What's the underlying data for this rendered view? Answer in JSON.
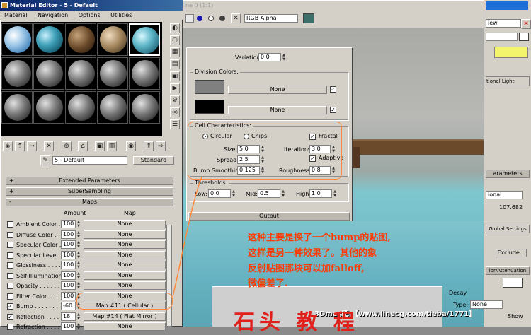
{
  "material_editor": {
    "title": "Material Editor - 5 - Default",
    "menu": [
      "Material",
      "Navigation",
      "Options",
      "Utilities"
    ],
    "material_name": "5 - Default",
    "material_type": "Standard",
    "rollouts": {
      "extended": "Extended Parameters",
      "supersampling": "SuperSampling",
      "maps": "Maps"
    },
    "maps_header": {
      "amount": "Amount",
      "map": "Map"
    },
    "maps": [
      {
        "label": "Ambient Color . .",
        "checked": false,
        "amount": "100",
        "map": "None"
      },
      {
        "label": "Diffuse Color . . .",
        "checked": false,
        "amount": "100",
        "map": "None"
      },
      {
        "label": "Specular Color . .",
        "checked": false,
        "amount": "100",
        "map": "None"
      },
      {
        "label": "Specular Level . .",
        "checked": false,
        "amount": "100",
        "map": "None"
      },
      {
        "label": "Glossiness . . . . .",
        "checked": false,
        "amount": "100",
        "map": "None"
      },
      {
        "label": "Self-Illumination .",
        "checked": false,
        "amount": "100",
        "map": "None"
      },
      {
        "label": "Opacity . . . . . .",
        "checked": false,
        "amount": "100",
        "map": "None"
      },
      {
        "label": "Filter Color . . .",
        "checked": false,
        "amount": "100",
        "map": "None"
      },
      {
        "label": "Bump . . . . . . .",
        "checked": true,
        "amount": "-60",
        "map": "Map #11  ( Cellular )"
      },
      {
        "label": "Reflection . . . .",
        "checked": true,
        "amount": "18",
        "map": "Map #14  ( Flat Mirror )"
      },
      {
        "label": "Refraction . . . .",
        "checked": false,
        "amount": "100",
        "map": "None"
      }
    ]
  },
  "render_window": {
    "title": "ne 0 (1:1)",
    "channel": "RGB Alpha"
  },
  "cellular": {
    "variation_label": "Variation:",
    "variation": "0.0",
    "division_colors_label": "Division Colors:",
    "color1_map": "None",
    "color2_map": "None",
    "cell_char_label": "Cell Characteristics:",
    "circular": "Circular",
    "chips": "Chips",
    "fractal": "Fractal",
    "adaptive": "Adaptive",
    "size_label": "Size:",
    "size": "5.0",
    "spread_label": "Spread:",
    "spread": "2.5",
    "bump_smoothing_label": "Bump Smoothing:",
    "bump_smoothing": "0.125",
    "iterations_label": "Iterations:",
    "iterations": "3.0",
    "roughness_label": "Roughness:",
    "roughness": "0.8",
    "thresholds_label": "Thresholds:",
    "low_label": "Low:",
    "low": "0.0",
    "mid_label": "Mid:",
    "mid": "0.5",
    "high_label": "High:",
    "high": "1.0",
    "output_label": "Output"
  },
  "command_panel": {
    "view_label": "iew",
    "light_label": "tional Light",
    "parameters_label": "arameters",
    "dropdown_value": "ional",
    "value_readout": "107.682",
    "global_settings": "Global Settings",
    "exclude": "Exclude...",
    "attenuation": "ior/Attenuation",
    "decay_label": "Decay",
    "type_label": "Type:",
    "type_value": "None",
    "show_label": "Show"
  },
  "annotation": {
    "line1": "这种主要是换了一个bump的贴图,",
    "line2": "这样是另一种效果了。其他的象",
    "line3": "反射贴图那块可以加falloff,",
    "line4": "微偏差了.",
    "watermark": "3Dmax吧 【www.linecg.com/tieba/1771】",
    "bottom_big": "石头 教 程"
  },
  "colors": {
    "ui_gray": "#d4d0c8",
    "title_blue": "#0a246a",
    "annotation_orange": "#ff8a3c",
    "annotation_text": "#ff3a00"
  }
}
